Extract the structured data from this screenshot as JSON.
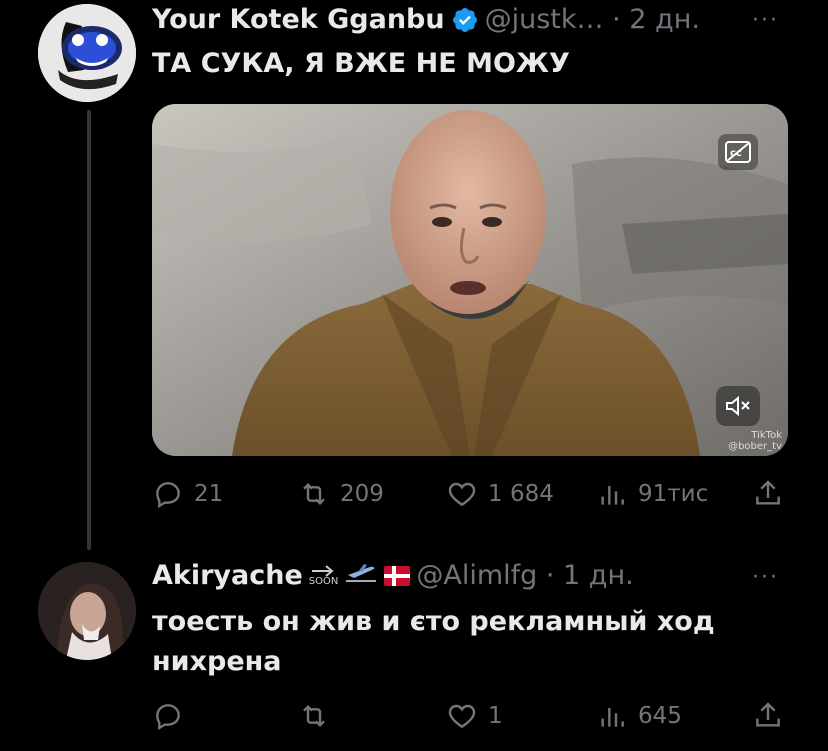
{
  "tweet1": {
    "display_name": "Your Kotek Gganbu",
    "handle_meta": "@justk… · 2 дн.",
    "more": "···",
    "text": "ТА СУКА, Я ВЖЕ НЕ МОЖУ",
    "media": {
      "watermark_brand": "TikTok",
      "watermark_user": "@bober_tv"
    },
    "actions": {
      "replies": "21",
      "reposts": "209",
      "likes": "1 684",
      "views": "91тис"
    }
  },
  "tweet2": {
    "display_name": "Akiryache",
    "soon_label": "SOON",
    "handle_meta": "@Alimlfg · 1 дн.",
    "more": "···",
    "text_line1": "тоесть он жив и єто рекламный ход",
    "text_line2": "нихрена",
    "actions": {
      "replies": "",
      "reposts": "",
      "likes": "1",
      "views": "645"
    }
  },
  "colors": {
    "background": "#000000",
    "text_primary": "#e7e9ea",
    "text_secondary": "#71767b",
    "verified": "#1d9bf0",
    "thread_line": "#333639"
  }
}
